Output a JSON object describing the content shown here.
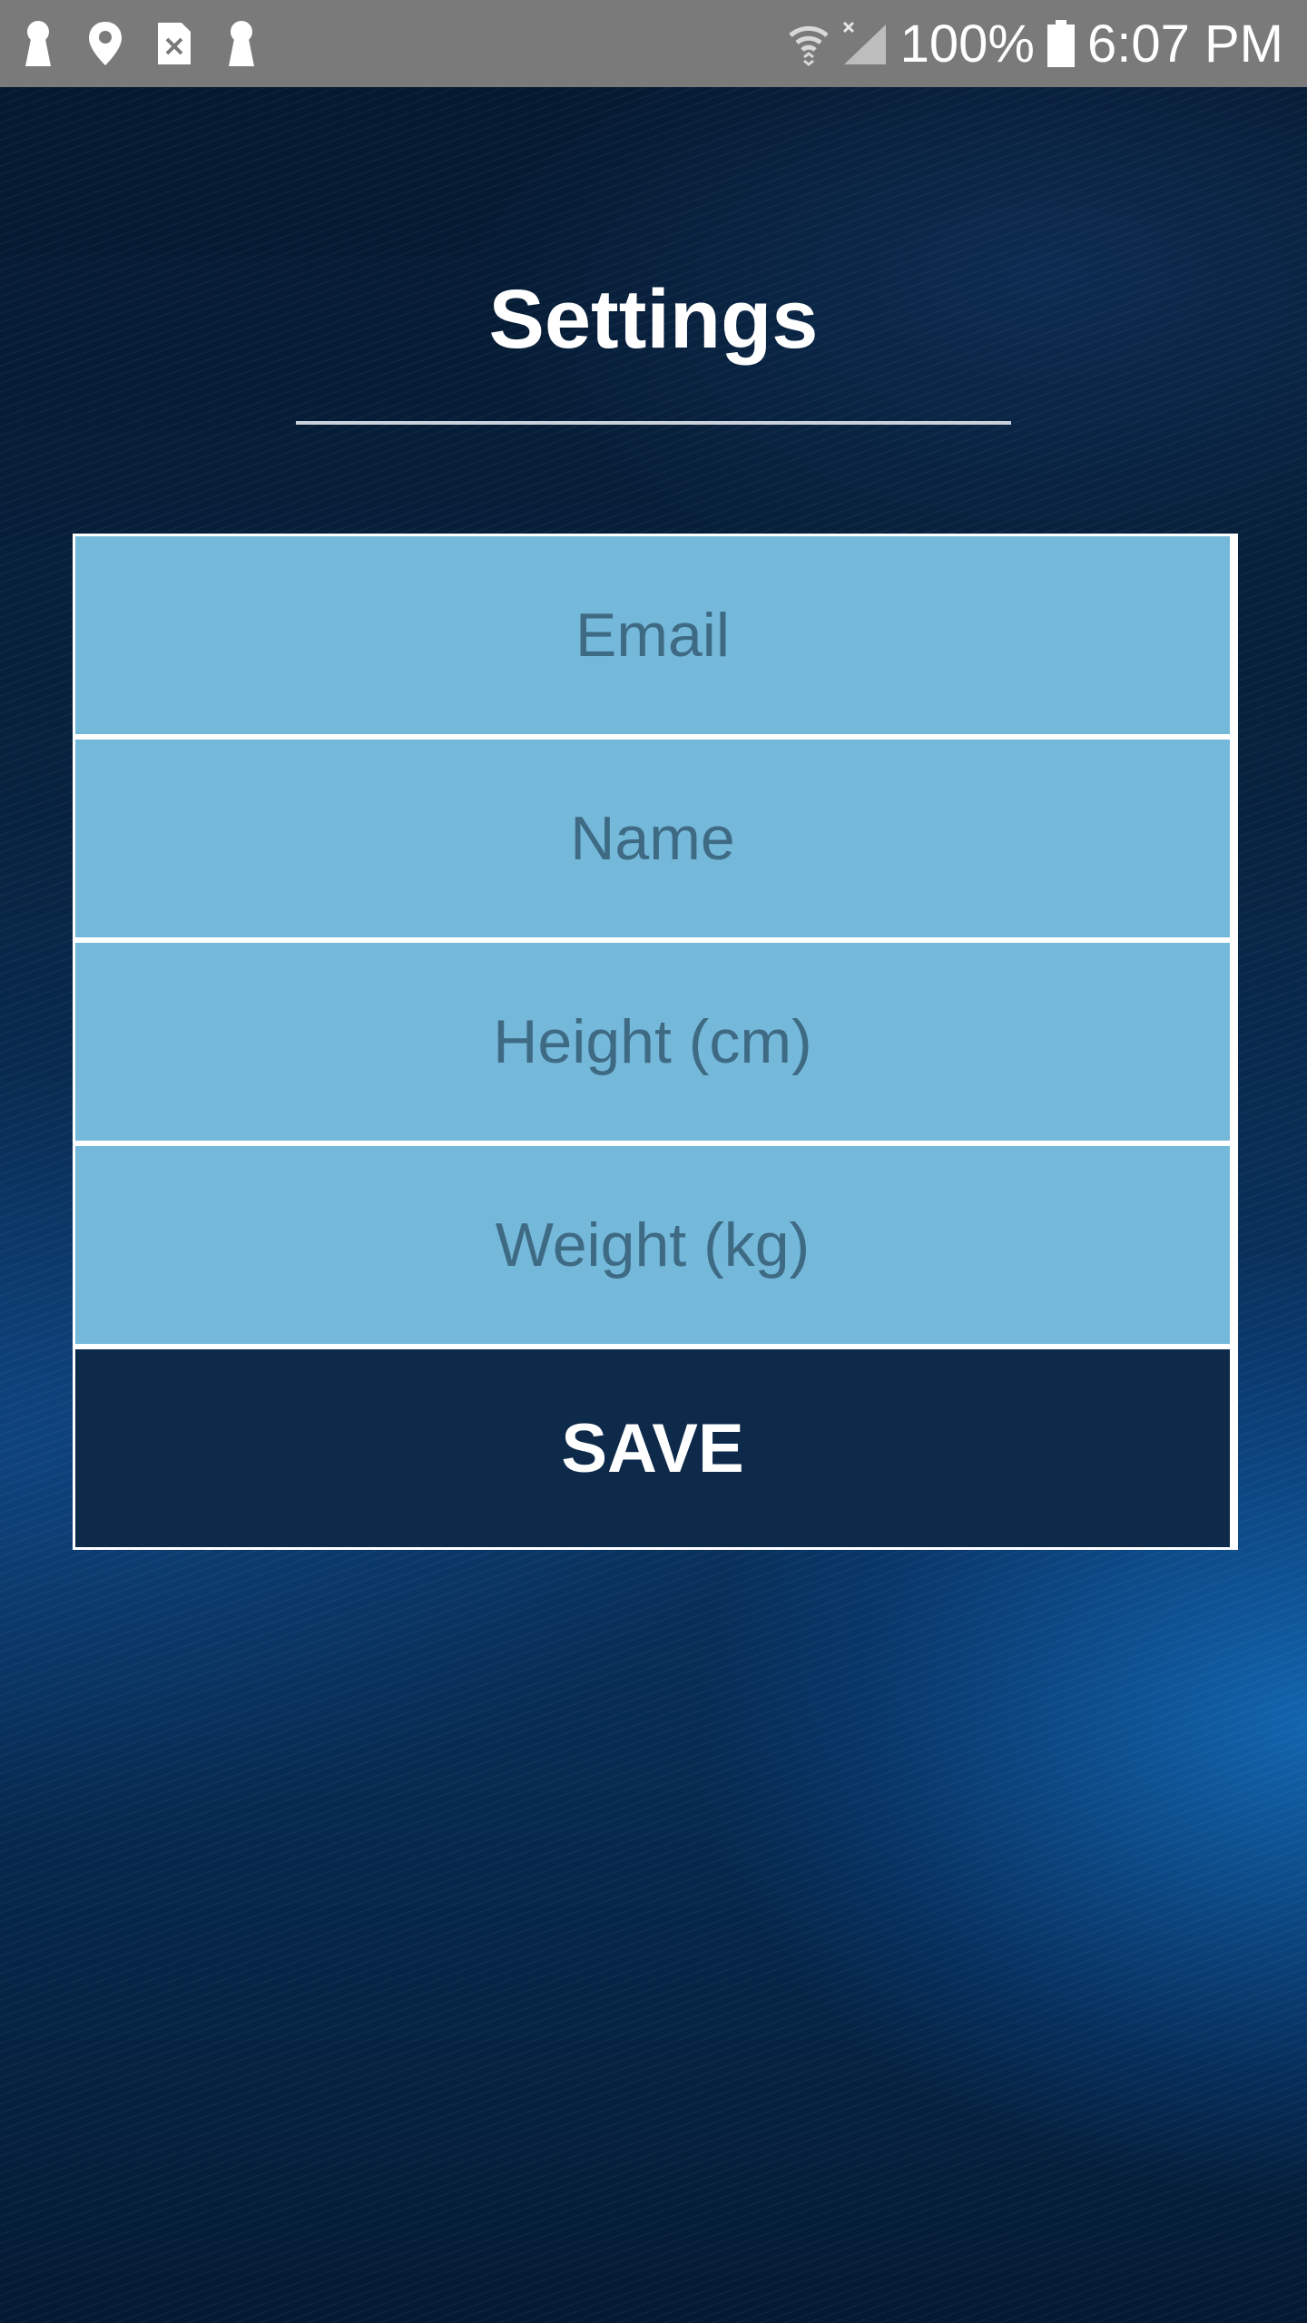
{
  "status_bar": {
    "battery_text": "100%",
    "time": "6:07 PM",
    "icons_left": [
      "keyhole-icon",
      "location-pin-icon",
      "sim-error-icon",
      "keyhole-icon"
    ],
    "icons_right": [
      "wifi-icon",
      "signal-off-icon",
      "battery-icon"
    ]
  },
  "page": {
    "title": "Settings"
  },
  "form": {
    "email_placeholder": "Email",
    "name_placeholder": "Name",
    "height_placeholder": "Height (cm)",
    "weight_placeholder": "Weight (kg)",
    "save_label": "SAVE"
  },
  "colors": {
    "field_bg": "#74b8da",
    "field_text": "#3f6a84",
    "button_bg": "#0e2a4b",
    "status_bar_bg": "#7a7a7a"
  }
}
